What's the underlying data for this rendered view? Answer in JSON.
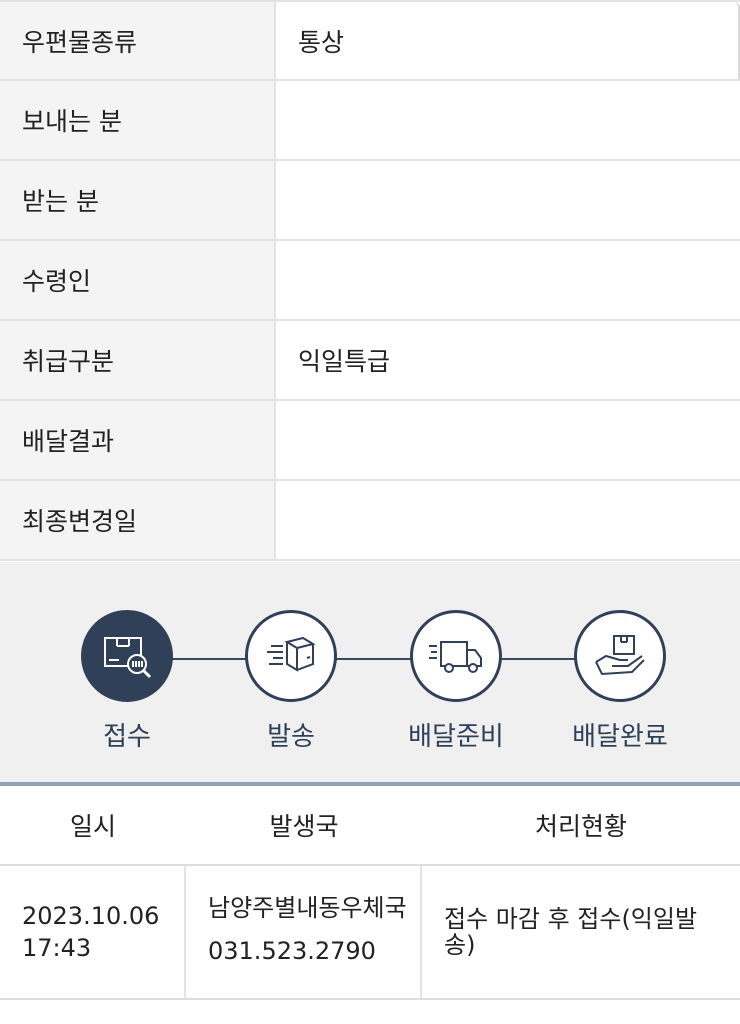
{
  "info": [
    {
      "label": "우편물종류",
      "value": "통상"
    },
    {
      "label": "보내는 분",
      "value": ""
    },
    {
      "label": "받는 분",
      "value": ""
    },
    {
      "label": "수령인",
      "value": ""
    },
    {
      "label": "취급구분",
      "value": "익일특급"
    },
    {
      "label": "배달결과",
      "value": ""
    },
    {
      "label": "최종변경일",
      "value": ""
    }
  ],
  "steps": [
    {
      "label": "접수",
      "icon": "box-search-icon",
      "active": true
    },
    {
      "label": "발송",
      "icon": "moving-box-icon",
      "active": false
    },
    {
      "label": "배달준비",
      "icon": "delivery-truck-icon",
      "active": false
    },
    {
      "label": "배달완료",
      "icon": "hand-box-icon",
      "active": false
    }
  ],
  "history": {
    "headers": [
      "일시",
      "발생국",
      "처리현황"
    ],
    "rows": [
      {
        "date": "2023.10.06",
        "time": "17:43",
        "office": "남양주별내동우체국",
        "phone": "031.523.2790",
        "status": "접수 마감 후 접수(익일발송)"
      }
    ]
  },
  "colors": {
    "accent": "#2f4058",
    "divider": "#8da3bd",
    "label_bg": "#f4f4f4"
  }
}
